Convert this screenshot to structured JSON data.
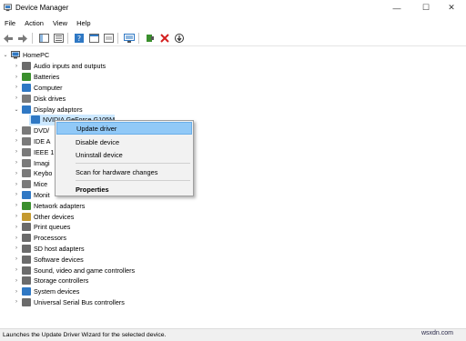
{
  "window": {
    "title": "Device Manager"
  },
  "menu": [
    "File",
    "Action",
    "View",
    "Help"
  ],
  "tree": {
    "root": "HomePC",
    "items": [
      {
        "label": "Audio inputs and outputs",
        "icon": "speaker-icon",
        "color": "#6b6b6b"
      },
      {
        "label": "Batteries",
        "icon": "battery-icon",
        "color": "#3a8f2d"
      },
      {
        "label": "Computer",
        "icon": "computer-icon",
        "color": "#2f78c4"
      },
      {
        "label": "Disk drives",
        "icon": "disk-icon",
        "color": "#7a7a7a"
      },
      {
        "label": "Display adaptors",
        "icon": "monitor-icon",
        "color": "#2f78c4"
      },
      {
        "label": "NVIDIA GeForce G105M",
        "icon": "display-card-icon",
        "color": "#2f78c4"
      },
      {
        "label": "DVD/",
        "icon": "dvd-icon",
        "color": "#7a7a7a"
      },
      {
        "label": "IDE A",
        "icon": "ide-icon",
        "color": "#7a7a7a"
      },
      {
        "label": "IEEE 1",
        "icon": "ieee-icon",
        "color": "#7a7a7a"
      },
      {
        "label": "Imagi",
        "icon": "camera-icon",
        "color": "#7a7a7a"
      },
      {
        "label": "Keybo",
        "icon": "keyboard-icon",
        "color": "#7a7a7a"
      },
      {
        "label": "Mice",
        "icon": "mouse-icon",
        "color": "#7a7a7a"
      },
      {
        "label": "Monit",
        "icon": "monitor-icon",
        "color": "#2f78c4"
      },
      {
        "label": "Network adapters",
        "icon": "network-icon",
        "color": "#3a8f2d"
      },
      {
        "label": "Other devices",
        "icon": "other-devices-icon",
        "color": "#c49a2f"
      },
      {
        "label": "Print queues",
        "icon": "printer-icon",
        "color": "#6b6b6b"
      },
      {
        "label": "Processors",
        "icon": "processor-icon",
        "color": "#6b6b6b"
      },
      {
        "label": "SD host adapters",
        "icon": "sd-card-icon",
        "color": "#6b6b6b"
      },
      {
        "label": "Software devices",
        "icon": "software-icon",
        "color": "#6b6b6b"
      },
      {
        "label": "Sound, video and game controllers",
        "icon": "sound-icon",
        "color": "#6b6b6b"
      },
      {
        "label": "Storage controllers",
        "icon": "storage-icon",
        "color": "#6b6b6b"
      },
      {
        "label": "System devices",
        "icon": "system-icon",
        "color": "#2f78c4"
      },
      {
        "label": "Universal Serial Bus controllers",
        "icon": "usb-icon",
        "color": "#6b6b6b"
      }
    ]
  },
  "context_menu": {
    "update": "Update driver",
    "disable": "Disable device",
    "uninstall": "Uninstall device",
    "scan": "Scan for hardware changes",
    "properties": "Properties"
  },
  "status": "Launches the Update Driver Wizard for the selected device.",
  "watermark": "wsxdn.com",
  "colors": {
    "highlight": "#91c9f7",
    "selection": "#cce8ff",
    "accent": "#2f78c4"
  }
}
